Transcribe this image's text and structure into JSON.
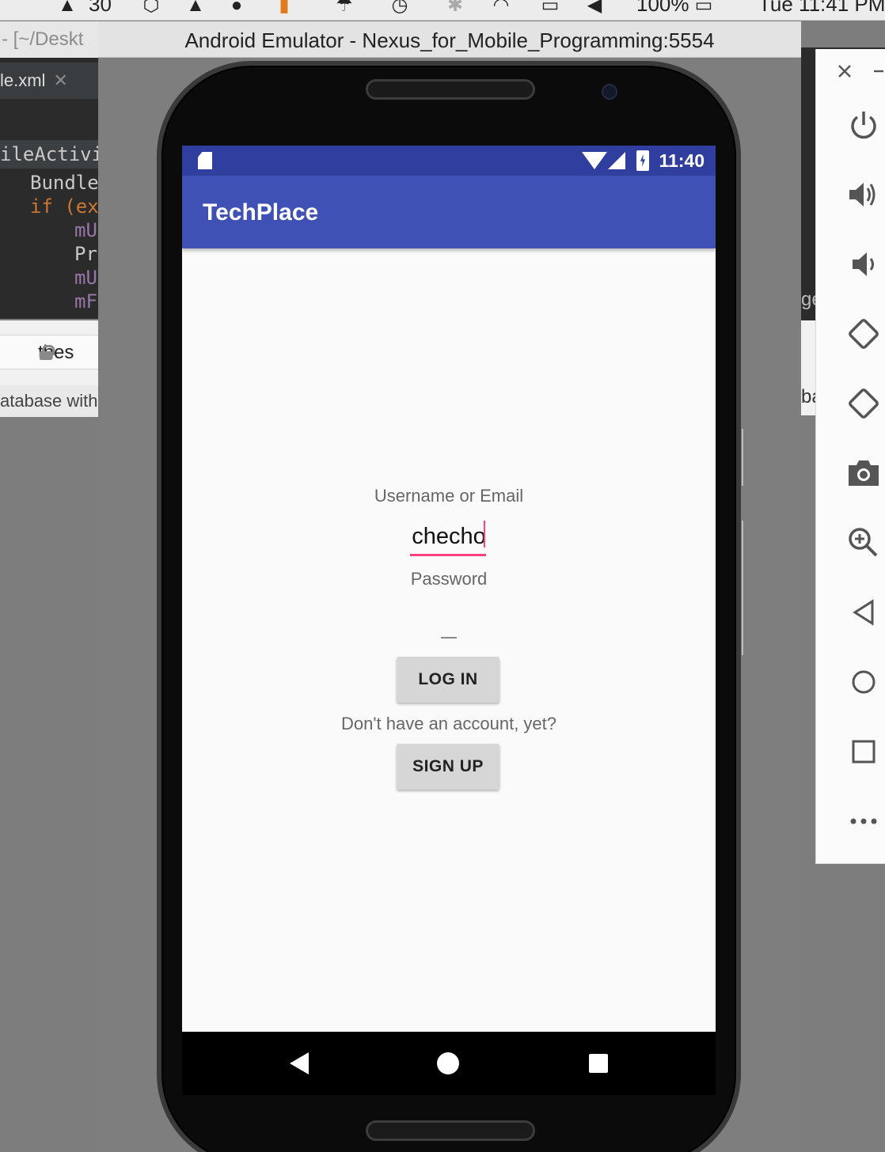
{
  "menubar": {
    "counter": "30",
    "battery_percent": "100%",
    "clock": "Tue 11:41 PM"
  },
  "background_left": {
    "path": "- [~/Deskt",
    "tab_name": "le.xml",
    "breadcrumb": "ileActivit",
    "code_lines": [
      "Bundle",
      "if (ex",
      "mU",
      "Pr",
      "mU",
      "mF"
    ],
    "browser_url": "thes",
    "browser_subtitle": "atabase with"
  },
  "background_right": {
    "code_tail": "ge",
    "light_tail": "ba"
  },
  "emulator": {
    "window_title": "Android Emulator - Nexus_for_Mobile_Programming:5554"
  },
  "status_bar": {
    "time": "11:40"
  },
  "app": {
    "title": "TechPlace",
    "username_label": "Username or Email",
    "username_value": "checho",
    "password_label": "Password",
    "password_value": "",
    "login_button": "LOG IN",
    "signup_prompt": "Don't have an account, yet?",
    "signup_button": "SIGN UP"
  },
  "colors": {
    "status_bar": "#303f9f",
    "app_bar": "#3f51b5",
    "accent": "#ff4081",
    "button": "#d6d6d6"
  },
  "toolbar": {
    "icons": [
      "close-icon",
      "minimize-icon",
      "power-icon",
      "volume-up-icon",
      "volume-down-icon",
      "rotate-left-icon",
      "rotate-right-icon",
      "camera-icon",
      "zoom-icon",
      "back-icon",
      "home-icon",
      "overview-icon",
      "more-icon"
    ]
  },
  "nav_bar": {
    "icons": [
      "back-icon",
      "home-icon",
      "recents-icon"
    ]
  }
}
